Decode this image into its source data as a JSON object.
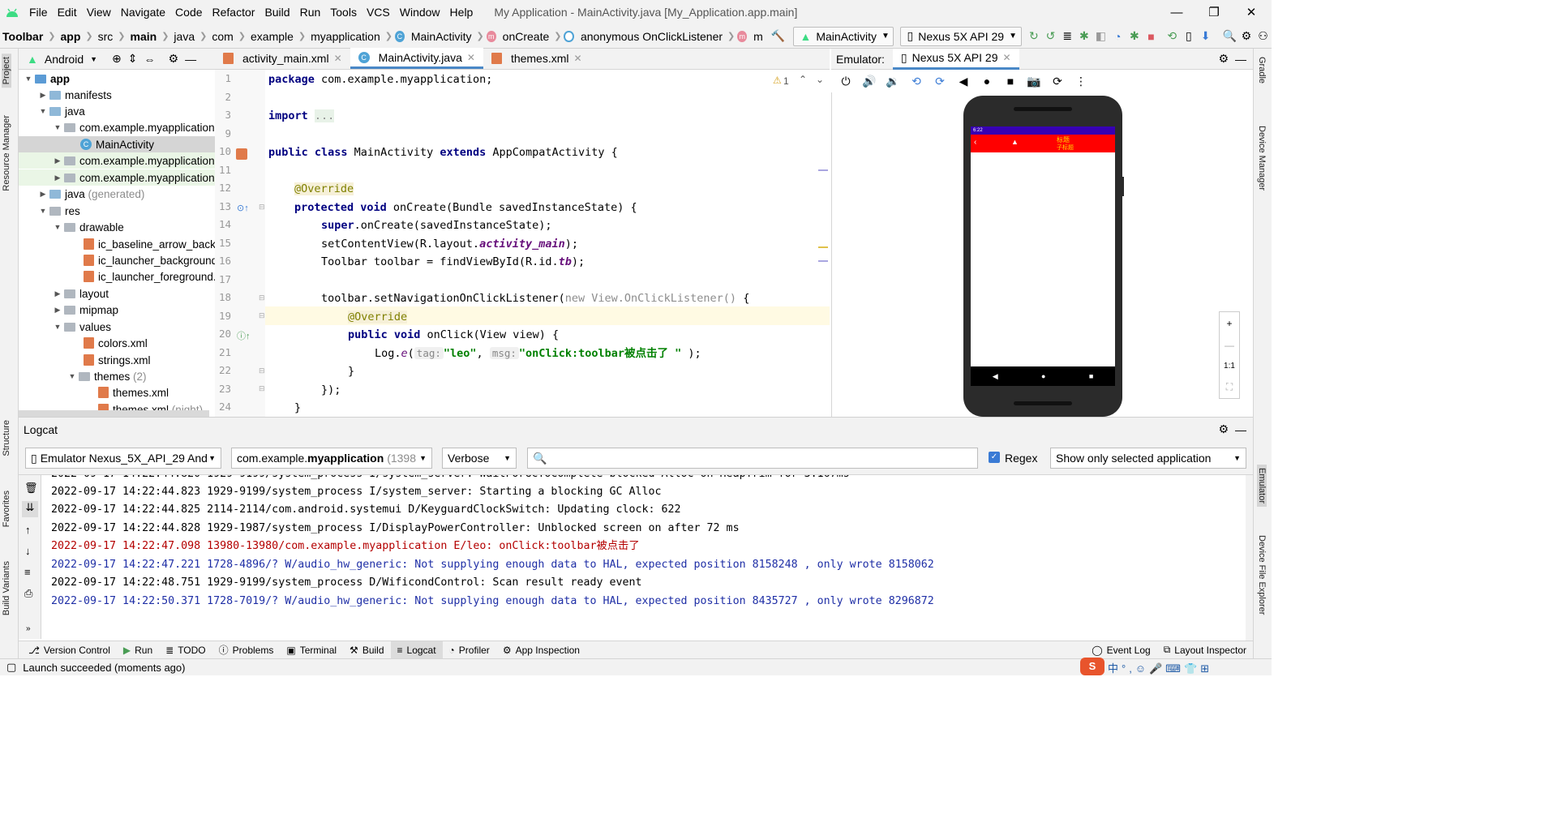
{
  "menubar": {
    "items": [
      "File",
      "Edit",
      "View",
      "Navigate",
      "Code",
      "Refactor",
      "Build",
      "Run",
      "Tools",
      "VCS",
      "Window",
      "Help"
    ],
    "title": "My Application - MainActivity.java [My_Application.app.main]"
  },
  "breadcrumbs": {
    "items": [
      "Toolbar",
      "app",
      "src",
      "main",
      "java",
      "com",
      "example",
      "myapplication",
      "MainActivity",
      "onCreate",
      "anonymous OnClickListener",
      "m"
    ],
    "run_config": "MainActivity",
    "device": "Nexus 5X API 29"
  },
  "project": {
    "view": "Android",
    "tree": [
      {
        "label": "app",
        "bold": true
      },
      {
        "label": "manifests"
      },
      {
        "label": "java"
      },
      {
        "label": "com.example.myapplication"
      },
      {
        "label": "MainActivity"
      },
      {
        "label": "com.example.myapplication"
      },
      {
        "label": "com.example.myapplication"
      },
      {
        "label": "java",
        "suffix": "(generated)"
      },
      {
        "label": "res"
      },
      {
        "label": "drawable"
      },
      {
        "label": "ic_baseline_arrow_back_"
      },
      {
        "label": "ic_launcher_background"
      },
      {
        "label": "ic_launcher_foreground."
      },
      {
        "label": "layout"
      },
      {
        "label": "mipmap"
      },
      {
        "label": "values"
      },
      {
        "label": "colors.xml"
      },
      {
        "label": "strings.xml"
      },
      {
        "label": "themes",
        "suffix": "(2)"
      },
      {
        "label": "themes.xml"
      },
      {
        "label": "themes.xml",
        "suffix": "(night)"
      }
    ]
  },
  "editor": {
    "tabs": [
      "activity_main.xml",
      "MainActivity.java",
      "themes.xml"
    ],
    "active_tab": "MainActivity.java",
    "warnings": "1",
    "lines": [
      "1",
      "2",
      "3",
      "9",
      "10",
      "11",
      "12",
      "13",
      "14",
      "15",
      "16",
      "17",
      "18",
      "19",
      "20",
      "21",
      "22",
      "23",
      "24"
    ],
    "code": {
      "l1a": "package ",
      "l1b": "com.example.myapplication;",
      "l3a": "import ",
      "l3b": "...",
      "l10a": "public class ",
      "l10b": "MainActivity ",
      "l10c": "extends ",
      "l10d": "AppCompatActivity {",
      "l12": "@Override",
      "l13a": "protected void ",
      "l13b": "onCreate(Bundle savedInstanceState) {",
      "l14a": "super",
      "l14b": ".onCreate(savedInstanceState);",
      "l15a": "setContentView(R.layout.",
      "l15b": "activity_main",
      "l15c": ");",
      "l16a": "Toolbar toolbar = findViewById(R.id.",
      "l16b": "tb",
      "l16c": ");",
      "l18a": "toolbar.setNavigationOnClickListener(",
      "l18b": "new ",
      "l18c": "View.OnClickListener() ",
      "l18d": "{",
      "l19": "@Override",
      "l20a": "public void ",
      "l20b": "onClick(View view) {",
      "l21a": "Log.",
      "l21b": "e",
      "l21c": "(",
      "l21d": "tag:",
      "l21e": "\"leo\"",
      "l21f": ", ",
      "l21g": "msg:",
      "l21h": "\"onClick:toolbar被点击了 \"",
      "l21i": " );",
      "l22": "}",
      "l23": "});",
      "l24": "}"
    }
  },
  "emulator": {
    "label": "Emulator:",
    "tab": "Nexus 5X API 29",
    "app_title": "标题",
    "app_subtitle": "子标题",
    "status_time": "6:22",
    "zoom_ratio": "1:1"
  },
  "logcat": {
    "title": "Logcat",
    "device": "Emulator Nexus_5X_API_29 Andr",
    "package_prefix": "com.example.",
    "package_bold": "myapplication",
    "package_pid": "(1398",
    "level": "Verbose",
    "search_placeholder": "",
    "regex_label": "Regex",
    "filter": "Show only selected application",
    "lines": [
      {
        "text": "2022-09-17 14:22:44.823 1929-9199/system_process I/system_server: Starting a blocking GC Alloc",
        "color": "#000000"
      },
      {
        "text": "2022-09-17 14:22:44.825 2114-2114/com.android.systemui D/KeyguardClockSwitch: Updating clock: 622",
        "color": "#000000"
      },
      {
        "text": "2022-09-17 14:22:44.828 1929-1987/system_process I/DisplayPowerController: Unblocked screen on after 72 ms",
        "color": "#000000"
      },
      {
        "text": "2022-09-17 14:22:47.098 13980-13980/com.example.myapplication E/leo: onClick:toolbar被点击了",
        "color": "#b40000"
      },
      {
        "text": "2022-09-17 14:22:47.221 1728-4896/? W/audio_hw_generic: Not supplying enough data to HAL, expected position 8158248 , only wrote 8158062",
        "color": "#1f2fa6"
      },
      {
        "text": "2022-09-17 14:22:48.751 1929-9199/system_process D/WificondControl: Scan result ready event",
        "color": "#000000"
      },
      {
        "text": "2022-09-17 14:22:50.371 1728-7019/? W/audio_hw_generic: Not supplying enough data to HAL, expected position 8435727 , only wrote 8296872",
        "color": "#1f2fa6"
      }
    ]
  },
  "bottom_tabs": [
    "Version Control",
    "Run",
    "TODO",
    "Problems",
    "Terminal",
    "Build",
    "Logcat",
    "Profiler",
    "App Inspection"
  ],
  "bottom_right": [
    "Event Log",
    "Layout Inspector"
  ],
  "left_strip": [
    "Project",
    "Resource Manager",
    "Structure",
    "Favorites",
    "Build Variants"
  ],
  "right_strip": [
    "Gradle",
    "Device Manager",
    "Emulator",
    "Device File Explorer"
  ],
  "status": "Launch succeeded (moments ago)"
}
